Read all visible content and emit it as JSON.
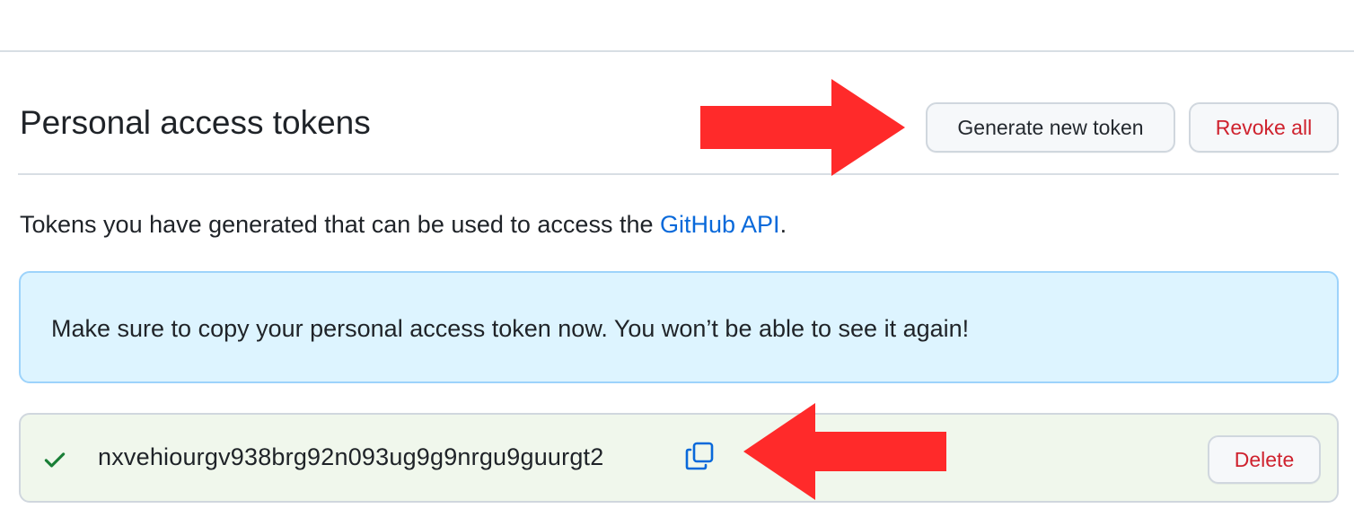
{
  "header": {
    "title": "Personal access tokens",
    "generate_button_label": "Generate new token",
    "revoke_all_button_label": "Revoke all"
  },
  "description": {
    "text_before_link": "Tokens you have generated that can be used to access the ",
    "link_text": "GitHub API",
    "text_after_link": "."
  },
  "flash": {
    "message": "Make sure to copy your personal access token now. You won’t be able to see it again!"
  },
  "token": {
    "value": "nxvehiourgv938brg92n093ug9g9nrgu9guurgt2",
    "delete_button_label": "Delete",
    "status_icon": "check-icon",
    "copy_icon": "copy-icon"
  },
  "colors": {
    "accent_blue": "#0969da",
    "danger_red": "#cf222e",
    "flash_bg": "#ddf4ff",
    "success_bg": "#f0f7ec",
    "success_green": "#1a7f37",
    "annotation_arrow": "#ff2a2a"
  }
}
